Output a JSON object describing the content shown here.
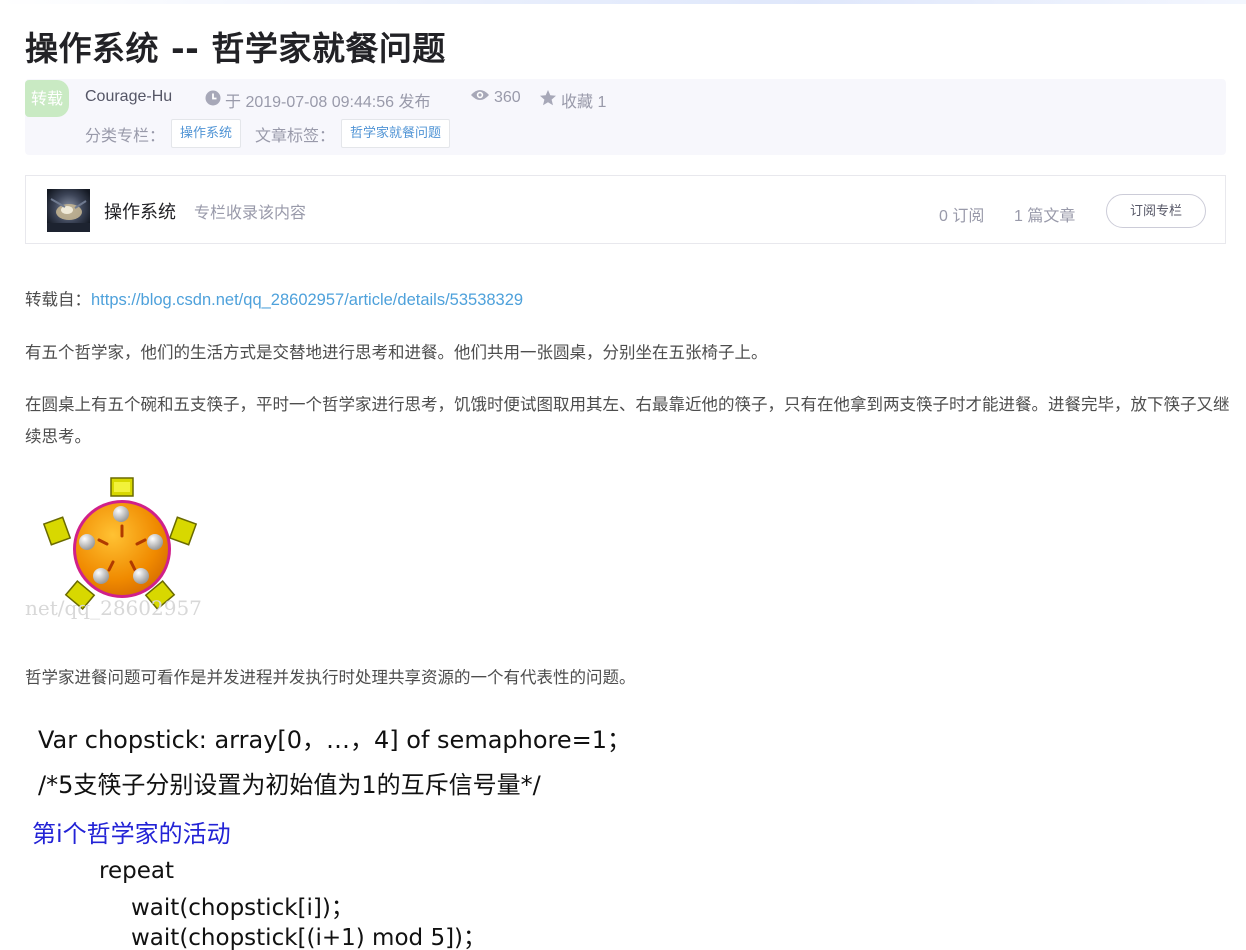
{
  "article": {
    "title": "操作系统 -- 哲学家就餐问题",
    "badge": "转载",
    "author": "Courage-Hu",
    "published": "于 2019-07-08 09:44:56 发布",
    "views": "360",
    "favorites": "收藏 1",
    "category_label": "分类专栏：",
    "category": "操作系统",
    "tags_label": "文章标签：",
    "tag": "哲学家就餐问题"
  },
  "column": {
    "name": "操作系统",
    "desc": "专栏收录该内容",
    "subscribers": "0 订阅",
    "articles": "1 篇文章",
    "subscribe_label": "订阅专栏"
  },
  "body": {
    "source_prefix": "转载自：",
    "source_url": "https://blog.csdn.net/qq_28602957/article/details/53538329",
    "p1": "有五个哲学家，他们的生活方式是交替地进行思考和进餐。他们共用一张圆桌，分别坐在五张椅子上。",
    "p2": "在圆桌上有五个碗和五支筷子，平时一个哲学家进行思考，饥饿时便试图取用其左、右最靠近他的筷子，只有在他拿到两支筷子时才能进餐。进餐完毕，放下筷子又继续思考。",
    "p3": "哲学家进餐问题可看作是并发进程并发执行时处理共享资源的一个有代表性的问题。",
    "watermark": "net/qq_28602957"
  },
  "code": {
    "line1": "Var chopstick: array[0，…，4] of semaphore=1；",
    "line2": "/*5支筷子分别设置为初始值为1的互斥信号量*/",
    "line3": "第i个哲学家的活动",
    "line4": "repeat",
    "line5": "wait(chopstick[i])；",
    "line6": "wait(chopstick[(i+1) mod 5])；"
  },
  "colors": {
    "link": "#4ea1db",
    "badge": "#c9eac3",
    "code_heading": "#2323d6"
  }
}
